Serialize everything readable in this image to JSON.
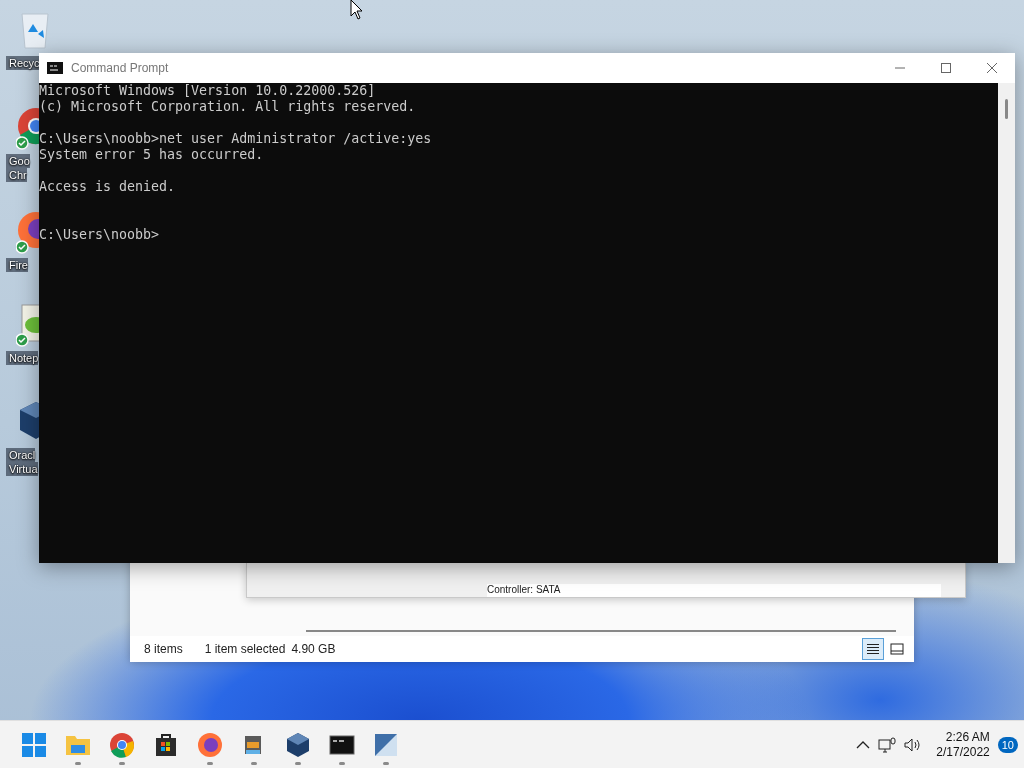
{
  "desktop_icons": [
    {
      "kind": "recycle-bin",
      "label": [
        "Recyc"
      ],
      "synced": false
    },
    {
      "kind": "chrome",
      "label": [
        "Goo",
        "Chr"
      ],
      "synced": true
    },
    {
      "kind": "firefox",
      "label": [
        "Fire"
      ],
      "synced": true
    },
    {
      "kind": "notepad",
      "label": [
        "Notep"
      ],
      "synced": true
    },
    {
      "kind": "virtualbox",
      "label": [
        "Oracl",
        "Virtua"
      ],
      "synced": false
    }
  ],
  "explorer_window": {
    "details_text": "Controller: SATA",
    "status_count": "8 items",
    "status_selection": "1 item selected",
    "status_size": "4.90 GB",
    "view_buttons": [
      {
        "kind": "details",
        "selected": true
      },
      {
        "kind": "tiles",
        "selected": false
      }
    ]
  },
  "cmd_window": {
    "title": "Command Prompt",
    "lines": [
      {
        "kind": "text",
        "text": "Microsoft Windows [Version 10.0.22000.526]"
      },
      {
        "kind": "text",
        "text": "(c) Microsoft Corporation. All rights reserved."
      },
      {
        "kind": "blank"
      },
      {
        "kind": "text",
        "text": "C:\\Users\\noobb>net user Administrator /active:yes"
      },
      {
        "kind": "text",
        "text": "System error 5 has occurred."
      },
      {
        "kind": "blank"
      },
      {
        "kind": "text",
        "text": "Access is denied."
      },
      {
        "kind": "blank"
      },
      {
        "kind": "blank"
      },
      {
        "kind": "text",
        "text": "C:\\Users\\noobb>"
      }
    ]
  },
  "taskbar": {
    "apps": [
      {
        "kind": "start",
        "running": false
      },
      {
        "kind": "explorer",
        "running": true
      },
      {
        "kind": "chrome",
        "running": true
      },
      {
        "kind": "store",
        "running": false
      },
      {
        "kind": "firefox",
        "running": true
      },
      {
        "kind": "installer",
        "running": true
      },
      {
        "kind": "virtualbox",
        "running": true
      },
      {
        "kind": "terminal",
        "running": true
      },
      {
        "kind": "tool",
        "running": true
      }
    ],
    "tray": {
      "time": "2:26 AM",
      "date": "2/17/2022",
      "notifications": "10"
    }
  }
}
